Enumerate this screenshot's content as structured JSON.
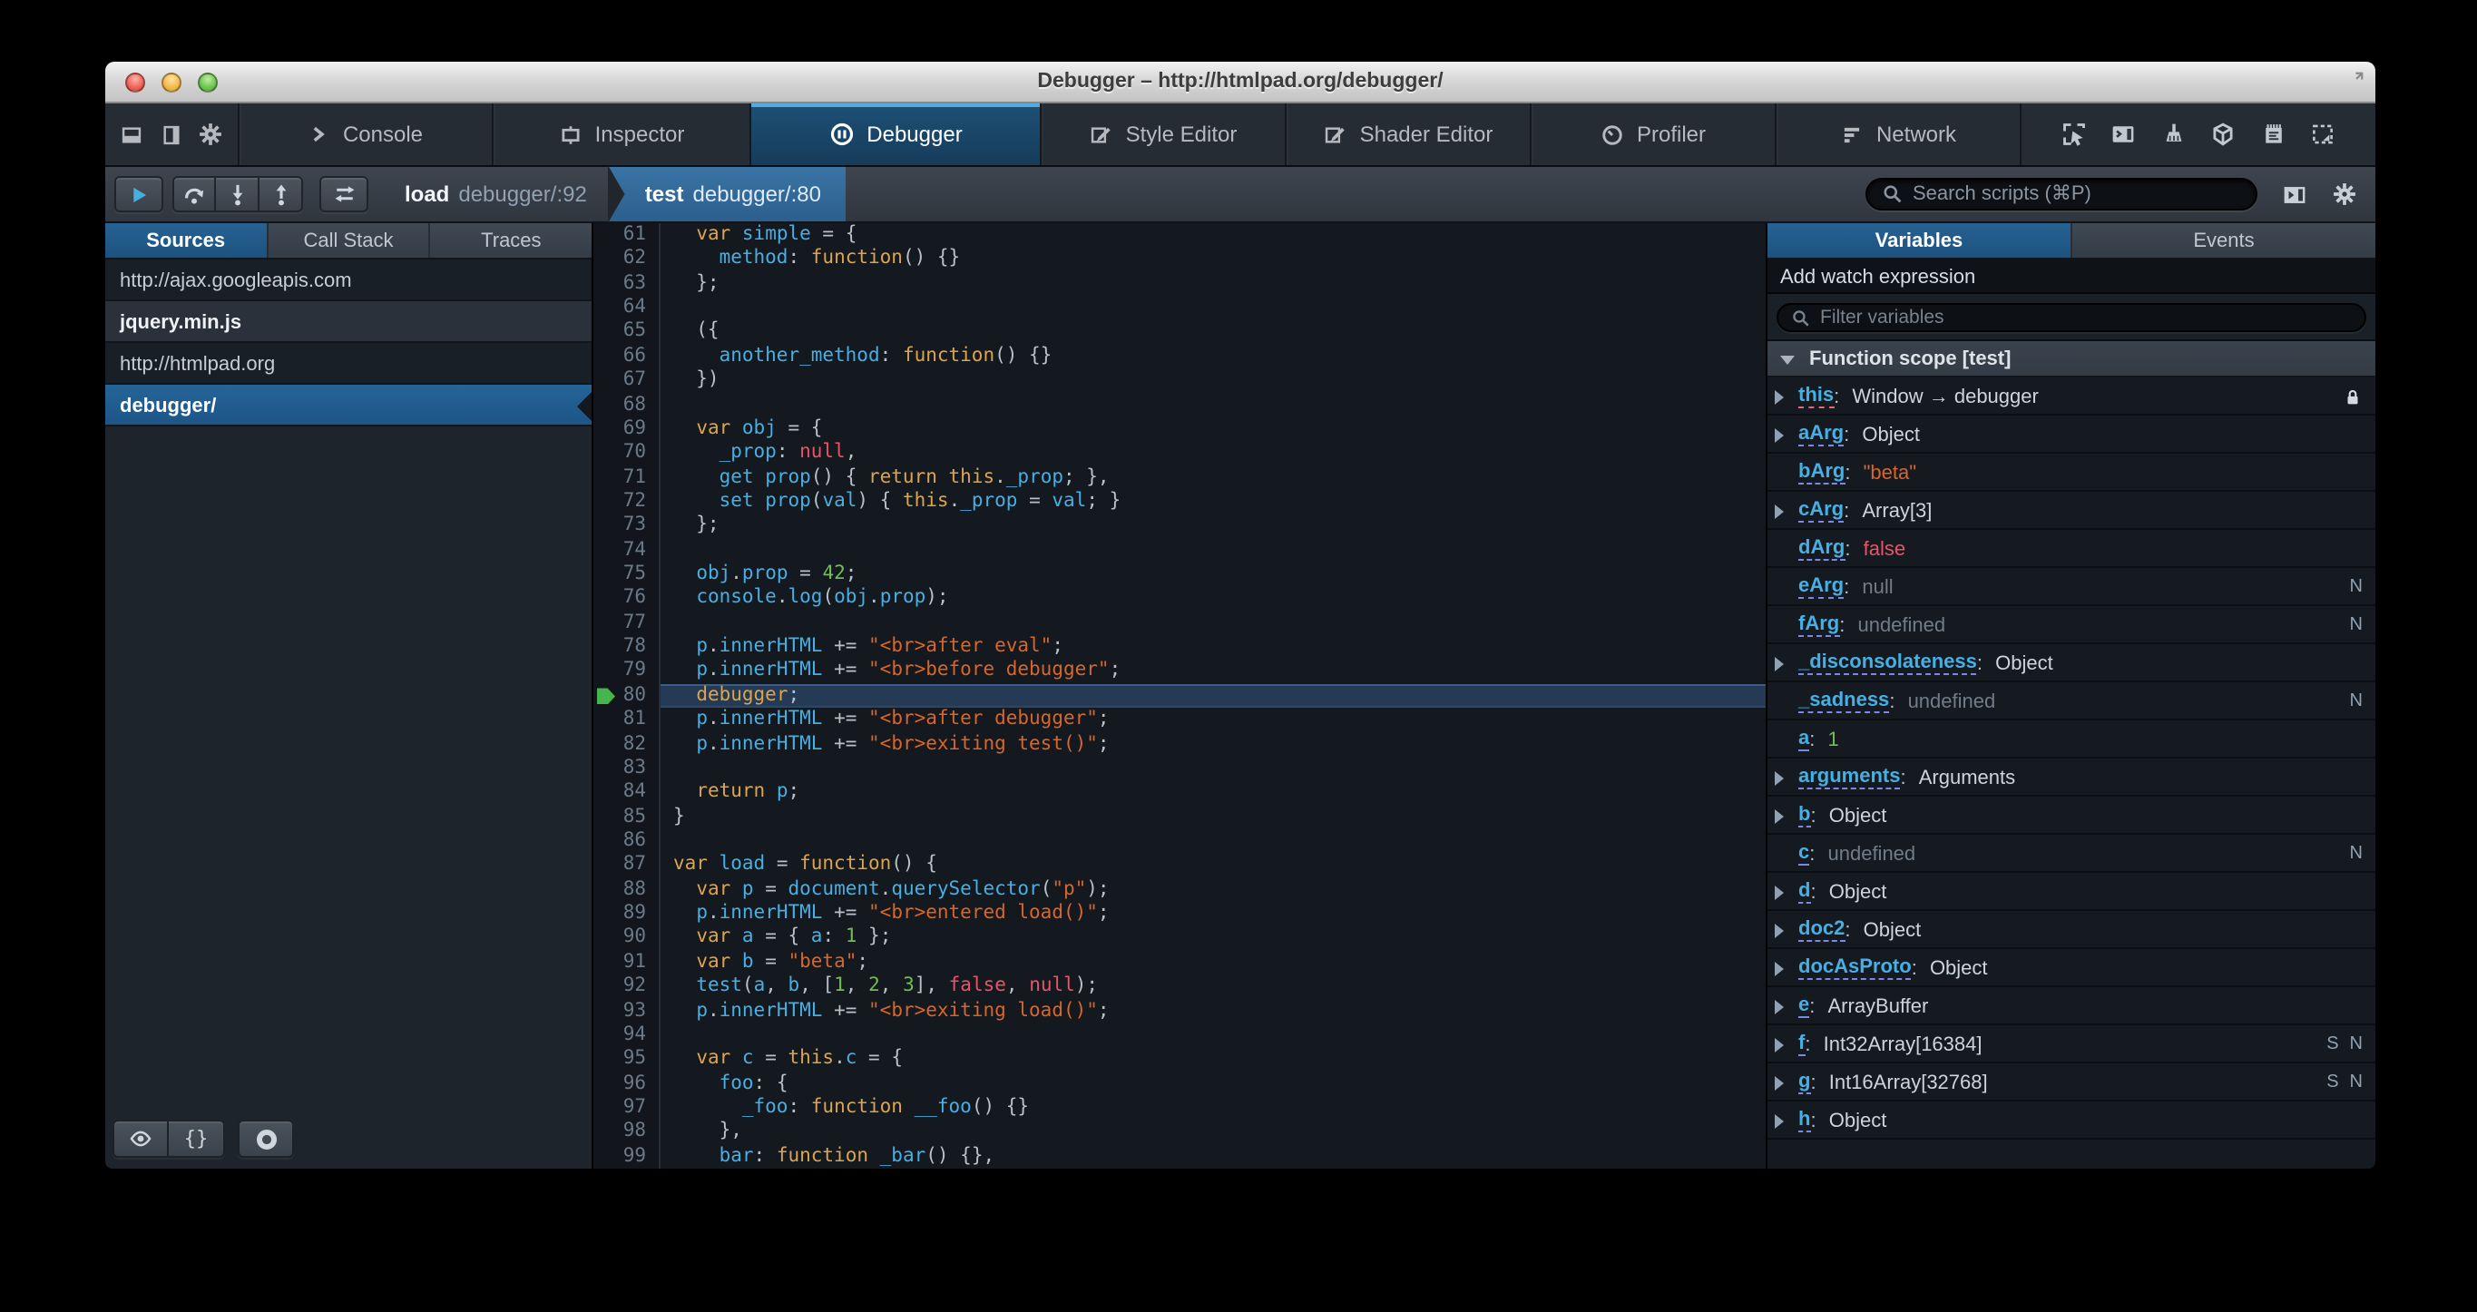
{
  "window": {
    "title": "Debugger – http://htmlpad.org/debugger/"
  },
  "colors": {
    "accent_blue": "#46afe3",
    "selection_blue": "#2c5f8d",
    "keyword": "#dca54c",
    "string": "#d96629",
    "number": "#70bf53",
    "atom": "#eb5368",
    "exec_arrow_green": "#46b54d"
  },
  "toolbox": {
    "dock_icons": [
      "dock-bottom-icon",
      "dock-side-icon",
      "gear-icon"
    ],
    "tabs": [
      {
        "label": "Console",
        "icon": "console-icon",
        "active": false
      },
      {
        "label": "Inspector",
        "icon": "inspector-icon",
        "active": false
      },
      {
        "label": "Debugger",
        "icon": "debugger-icon",
        "active": true
      },
      {
        "label": "Style Editor",
        "icon": "style-editor-icon",
        "active": false
      },
      {
        "label": "Shader Editor",
        "icon": "shader-editor-icon",
        "active": false
      },
      {
        "label": "Profiler",
        "icon": "profiler-icon",
        "active": false
      },
      {
        "label": "Network",
        "icon": "network-icon",
        "active": false
      }
    ],
    "right_icons": [
      "pick-icon",
      "split-console-icon",
      "paintbrush-icon",
      "tilt-3d-icon",
      "scratchpad-icon",
      "responsive-mode-icon"
    ]
  },
  "toolbar": {
    "debug_buttons": [
      "resume-icon",
      "step-over-icon",
      "step-in-icon",
      "step-out-icon"
    ],
    "toggle_button": "swap-icon",
    "breadcrumbs": [
      {
        "fn": "load",
        "loc": "debugger/:92",
        "selected": false
      },
      {
        "fn": "test",
        "loc": "debugger/:80",
        "selected": true
      }
    ],
    "search_placeholder": "Search scripts (⌘P)",
    "right_icons": [
      "panel-open-icon",
      "gear-icon"
    ]
  },
  "sidebar": {
    "tabs": [
      {
        "label": "Sources",
        "active": true
      },
      {
        "label": "Call Stack",
        "active": false
      },
      {
        "label": "Traces",
        "active": false
      }
    ],
    "items": [
      {
        "label": "http://ajax.googleapis.com",
        "kind": "host",
        "selected": false
      },
      {
        "label": "jquery.min.js",
        "kind": "file",
        "selected": false
      },
      {
        "label": "http://htmlpad.org",
        "kind": "host",
        "selected": false
      },
      {
        "label": "debugger/",
        "kind": "file",
        "selected": true
      }
    ],
    "footer_buttons": [
      "eye-icon",
      "braces-icon",
      "circle-icon"
    ]
  },
  "editor": {
    "first_line": 61,
    "highlighted_line": 80,
    "lines": [
      [
        [
          "p",
          "  "
        ],
        [
          "k",
          "var"
        ],
        [
          "p",
          " "
        ],
        [
          "v",
          "simple"
        ],
        [
          "p",
          " = {"
        ]
      ],
      [
        [
          "p",
          "    "
        ],
        [
          "v",
          "method"
        ],
        [
          "p",
          ": "
        ],
        [
          "k",
          "function"
        ],
        [
          "p",
          "() {}"
        ]
      ],
      [
        [
          "p",
          "  };"
        ]
      ],
      [],
      [
        [
          "p",
          "  ({"
        ]
      ],
      [
        [
          "p",
          "    "
        ],
        [
          "v",
          "another_method"
        ],
        [
          "p",
          ": "
        ],
        [
          "k",
          "function"
        ],
        [
          "p",
          "() {}"
        ]
      ],
      [
        [
          "p",
          "  })"
        ]
      ],
      [],
      [
        [
          "p",
          "  "
        ],
        [
          "k",
          "var"
        ],
        [
          "p",
          " "
        ],
        [
          "v",
          "obj"
        ],
        [
          "p",
          " = {"
        ]
      ],
      [
        [
          "p",
          "    "
        ],
        [
          "v",
          "_prop"
        ],
        [
          "p",
          ": "
        ],
        [
          "a",
          "null"
        ],
        [
          "p",
          ","
        ]
      ],
      [
        [
          "p",
          "    "
        ],
        [
          "v",
          "get"
        ],
        [
          "p",
          " "
        ],
        [
          "v",
          "prop"
        ],
        [
          "p",
          "() { "
        ],
        [
          "k",
          "return"
        ],
        [
          "p",
          " "
        ],
        [
          "k",
          "this"
        ],
        [
          "p",
          "."
        ],
        [
          "v",
          "_prop"
        ],
        [
          "p",
          "; },"
        ]
      ],
      [
        [
          "p",
          "    "
        ],
        [
          "v",
          "set"
        ],
        [
          "p",
          " "
        ],
        [
          "v",
          "prop"
        ],
        [
          "p",
          "("
        ],
        [
          "v",
          "val"
        ],
        [
          "p",
          ") { "
        ],
        [
          "k",
          "this"
        ],
        [
          "p",
          "."
        ],
        [
          "v",
          "_prop"
        ],
        [
          "p",
          " = "
        ],
        [
          "v",
          "val"
        ],
        [
          "p",
          "; }"
        ]
      ],
      [
        [
          "p",
          "  };"
        ]
      ],
      [],
      [
        [
          "p",
          "  "
        ],
        [
          "v",
          "obj"
        ],
        [
          "p",
          "."
        ],
        [
          "v",
          "prop"
        ],
        [
          "p",
          " = "
        ],
        [
          "n",
          "42"
        ],
        [
          "p",
          ";"
        ]
      ],
      [
        [
          "p",
          "  "
        ],
        [
          "v",
          "console"
        ],
        [
          "p",
          "."
        ],
        [
          "v",
          "log"
        ],
        [
          "p",
          "("
        ],
        [
          "v",
          "obj"
        ],
        [
          "p",
          "."
        ],
        [
          "v",
          "prop"
        ],
        [
          "p",
          ");"
        ]
      ],
      [],
      [
        [
          "p",
          "  "
        ],
        [
          "v",
          "p"
        ],
        [
          "p",
          "."
        ],
        [
          "v",
          "innerHTML"
        ],
        [
          "p",
          " += "
        ],
        [
          "s",
          "\"<br>after eval\""
        ],
        [
          "p",
          ";"
        ]
      ],
      [
        [
          "p",
          "  "
        ],
        [
          "v",
          "p"
        ],
        [
          "p",
          "."
        ],
        [
          "v",
          "innerHTML"
        ],
        [
          "p",
          " += "
        ],
        [
          "s",
          "\"<br>before debugger\""
        ],
        [
          "p",
          ";"
        ]
      ],
      [
        [
          "p",
          "  "
        ],
        [
          "k",
          "debugger"
        ],
        [
          "p",
          ";"
        ]
      ],
      [
        [
          "p",
          "  "
        ],
        [
          "v",
          "p"
        ],
        [
          "p",
          "."
        ],
        [
          "v",
          "innerHTML"
        ],
        [
          "p",
          " += "
        ],
        [
          "s",
          "\"<br>after debugger\""
        ],
        [
          "p",
          ";"
        ]
      ],
      [
        [
          "p",
          "  "
        ],
        [
          "v",
          "p"
        ],
        [
          "p",
          "."
        ],
        [
          "v",
          "innerHTML"
        ],
        [
          "p",
          " += "
        ],
        [
          "s",
          "\"<br>exiting test()\""
        ],
        [
          "p",
          ";"
        ]
      ],
      [],
      [
        [
          "p",
          "  "
        ],
        [
          "k",
          "return"
        ],
        [
          "p",
          " "
        ],
        [
          "v",
          "p"
        ],
        [
          "p",
          ";"
        ]
      ],
      [
        [
          "p",
          "}"
        ]
      ],
      [],
      [
        [
          "k",
          "var"
        ],
        [
          "p",
          " "
        ],
        [
          "v",
          "load"
        ],
        [
          "p",
          " = "
        ],
        [
          "k",
          "function"
        ],
        [
          "p",
          "() {"
        ]
      ],
      [
        [
          "p",
          "  "
        ],
        [
          "k",
          "var"
        ],
        [
          "p",
          " "
        ],
        [
          "v",
          "p"
        ],
        [
          "p",
          " = "
        ],
        [
          "v",
          "document"
        ],
        [
          "p",
          "."
        ],
        [
          "v",
          "querySelector"
        ],
        [
          "p",
          "("
        ],
        [
          "s",
          "\"p\""
        ],
        [
          "p",
          ");"
        ]
      ],
      [
        [
          "p",
          "  "
        ],
        [
          "v",
          "p"
        ],
        [
          "p",
          "."
        ],
        [
          "v",
          "innerHTML"
        ],
        [
          "p",
          " += "
        ],
        [
          "s",
          "\"<br>entered load()\""
        ],
        [
          "p",
          ";"
        ]
      ],
      [
        [
          "p",
          "  "
        ],
        [
          "k",
          "var"
        ],
        [
          "p",
          " "
        ],
        [
          "v",
          "a"
        ],
        [
          "p",
          " = { "
        ],
        [
          "v",
          "a"
        ],
        [
          "p",
          ": "
        ],
        [
          "n",
          "1"
        ],
        [
          "p",
          " };"
        ]
      ],
      [
        [
          "p",
          "  "
        ],
        [
          "k",
          "var"
        ],
        [
          "p",
          " "
        ],
        [
          "v",
          "b"
        ],
        [
          "p",
          " = "
        ],
        [
          "s",
          "\"beta\""
        ],
        [
          "p",
          ";"
        ]
      ],
      [
        [
          "p",
          "  "
        ],
        [
          "v",
          "test"
        ],
        [
          "p",
          "("
        ],
        [
          "v",
          "a"
        ],
        [
          "p",
          ", "
        ],
        [
          "v",
          "b"
        ],
        [
          "p",
          ", ["
        ],
        [
          "n",
          "1"
        ],
        [
          "p",
          ", "
        ],
        [
          "n",
          "2"
        ],
        [
          "p",
          ", "
        ],
        [
          "n",
          "3"
        ],
        [
          "p",
          "], "
        ],
        [
          "a",
          "false"
        ],
        [
          "p",
          ", "
        ],
        [
          "a",
          "null"
        ],
        [
          "p",
          ");"
        ]
      ],
      [
        [
          "p",
          "  "
        ],
        [
          "v",
          "p"
        ],
        [
          "p",
          "."
        ],
        [
          "v",
          "innerHTML"
        ],
        [
          "p",
          " += "
        ],
        [
          "s",
          "\"<br>exiting load()\""
        ],
        [
          "p",
          ";"
        ]
      ],
      [],
      [
        [
          "p",
          "  "
        ],
        [
          "k",
          "var"
        ],
        [
          "p",
          " "
        ],
        [
          "v",
          "c"
        ],
        [
          "p",
          " = "
        ],
        [
          "k",
          "this"
        ],
        [
          "p",
          "."
        ],
        [
          "v",
          "c"
        ],
        [
          "p",
          " = {"
        ]
      ],
      [
        [
          "p",
          "    "
        ],
        [
          "v",
          "foo"
        ],
        [
          "p",
          ": {"
        ]
      ],
      [
        [
          "p",
          "      "
        ],
        [
          "v",
          "_foo"
        ],
        [
          "p",
          ": "
        ],
        [
          "k",
          "function"
        ],
        [
          "p",
          " "
        ],
        [
          "v",
          "__foo"
        ],
        [
          "p",
          "() {}"
        ]
      ],
      [
        [
          "p",
          "    },"
        ]
      ],
      [
        [
          "p",
          "    "
        ],
        [
          "v",
          "bar"
        ],
        [
          "p",
          ": "
        ],
        [
          "k",
          "function"
        ],
        [
          "p",
          " "
        ],
        [
          "v",
          "_bar"
        ],
        [
          "p",
          "() {},"
        ]
      ]
    ]
  },
  "variables_panel": {
    "tabs": [
      {
        "label": "Variables",
        "active": true
      },
      {
        "label": "Events",
        "active": false
      }
    ],
    "watch_label": "Add watch expression",
    "filter_placeholder": "Filter variables",
    "scope_label": "Function scope [test]",
    "variables": [
      {
        "name": "this",
        "value": "Window → debugger",
        "vtype": "plain",
        "arrow": true,
        "lock": true,
        "badges": []
      },
      {
        "name": "aArg",
        "value": "Object",
        "vtype": "plain",
        "arrow": true,
        "lock": false,
        "badges": []
      },
      {
        "name": "bArg",
        "value": "\"beta\"",
        "vtype": "string",
        "arrow": false,
        "lock": false,
        "badges": []
      },
      {
        "name": "cArg",
        "value": "Array[3]",
        "vtype": "plain",
        "arrow": true,
        "lock": false,
        "badges": []
      },
      {
        "name": "dArg",
        "value": "false",
        "vtype": "atom",
        "arrow": false,
        "lock": false,
        "badges": []
      },
      {
        "name": "eArg",
        "value": "null",
        "vtype": "dim",
        "arrow": false,
        "lock": false,
        "badges": [
          "N"
        ]
      },
      {
        "name": "fArg",
        "value": "undefined",
        "vtype": "dim",
        "arrow": false,
        "lock": false,
        "badges": [
          "N"
        ]
      },
      {
        "name": "_disconsolateness",
        "value": "Object",
        "vtype": "plain",
        "arrow": true,
        "lock": false,
        "badges": []
      },
      {
        "name": "_sadness",
        "value": "undefined",
        "vtype": "dim",
        "arrow": false,
        "lock": false,
        "badges": [
          "N"
        ]
      },
      {
        "name": "a",
        "value": "1",
        "vtype": "number",
        "arrow": false,
        "lock": false,
        "badges": []
      },
      {
        "name": "arguments",
        "value": "Arguments",
        "vtype": "plain",
        "arrow": true,
        "lock": false,
        "badges": []
      },
      {
        "name": "b",
        "value": "Object",
        "vtype": "plain",
        "arrow": true,
        "lock": false,
        "badges": []
      },
      {
        "name": "c",
        "value": "undefined",
        "vtype": "dim",
        "arrow": false,
        "lock": false,
        "badges": [
          "N"
        ]
      },
      {
        "name": "d",
        "value": "Object",
        "vtype": "plain",
        "arrow": true,
        "lock": false,
        "badges": []
      },
      {
        "name": "doc2",
        "value": "Object",
        "vtype": "plain",
        "arrow": true,
        "lock": false,
        "badges": []
      },
      {
        "name": "docAsProto",
        "value": "Object",
        "vtype": "plain",
        "arrow": true,
        "lock": false,
        "badges": []
      },
      {
        "name": "e",
        "value": "ArrayBuffer",
        "vtype": "plain",
        "arrow": true,
        "lock": false,
        "badges": []
      },
      {
        "name": "f",
        "value": "Int32Array[16384]",
        "vtype": "plain",
        "arrow": true,
        "lock": false,
        "badges": [
          "S",
          "N"
        ]
      },
      {
        "name": "g",
        "value": "Int16Array[32768]",
        "vtype": "plain",
        "arrow": true,
        "lock": false,
        "badges": [
          "S",
          "N"
        ]
      },
      {
        "name": "h",
        "value": "Object",
        "vtype": "plain",
        "arrow": true,
        "lock": false,
        "badges": []
      }
    ]
  }
}
